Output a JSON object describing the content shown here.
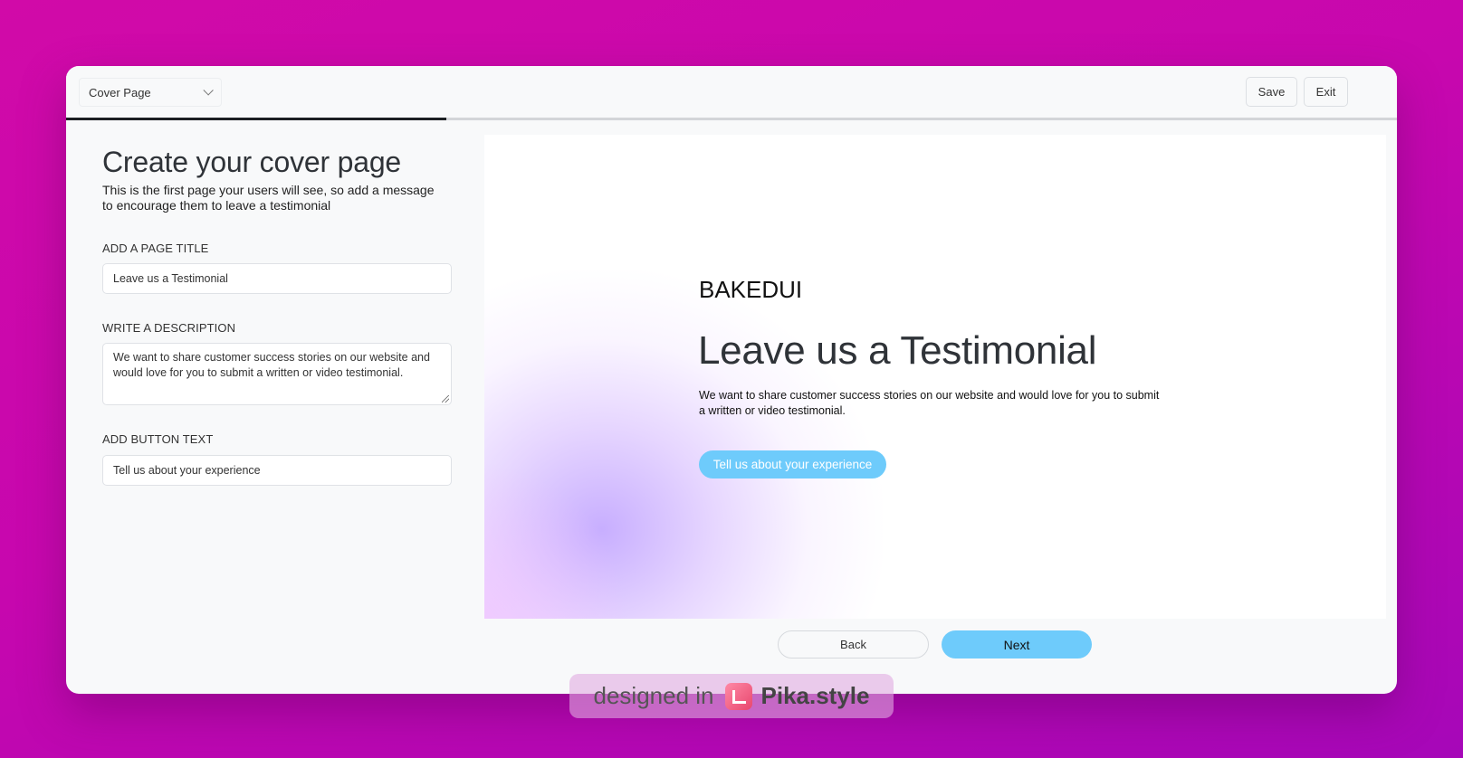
{
  "toolbar": {
    "page_select_value": "Cover Page",
    "save_label": "Save",
    "exit_label": "Exit"
  },
  "progress": {
    "fraction": 0.286
  },
  "editor": {
    "heading": "Create your cover page",
    "subheading": "This is the first page your users will see, so add a message to encourage them to leave a testimonial",
    "title_label": "ADD A PAGE TITLE",
    "title_value": "Leave us a Testimonial",
    "description_label": "WRITE A DESCRIPTION",
    "description_value": "We want to share customer success stories on our website and would love for you to submit a written or video testimonial.",
    "button_label": "ADD BUTTON TEXT",
    "button_value": "Tell us about your experience"
  },
  "preview": {
    "brand": "BAKEDUI",
    "title": "Leave us a Testimonial",
    "description": "We want to share customer success stories on our website and would love for you to submit a written or video testimonial.",
    "cta": "Tell us about your experience"
  },
  "nav": {
    "back_label": "Back",
    "next_label": "Next"
  },
  "watermark": {
    "prefix": "designed in",
    "brand": "Pika.style"
  },
  "colors": {
    "accent": "#6ecbfb",
    "progress": "#1c1f23",
    "background": "#c707ae"
  }
}
